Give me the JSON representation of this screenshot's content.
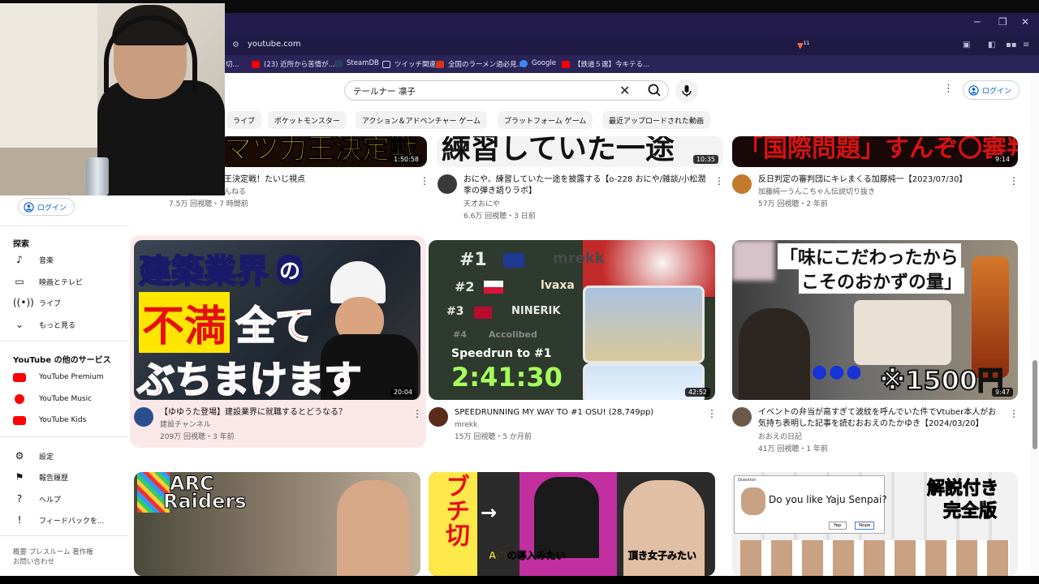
{
  "browser": {
    "url": "youtube.com",
    "shield_count": "11",
    "bookmarks": [
      {
        "label": "(23) 近所から苦情が...",
        "color": "#ff0000"
      },
      {
        "label": "SteamDB",
        "color": "#2a3f5f"
      },
      {
        "label": "ツイッチ関連",
        "color": "#9146ff"
      },
      {
        "label": "全国のラーメン過必見...",
        "color": "#d9331a"
      },
      {
        "label": "Google",
        "color": "#4285f4"
      },
      {
        "label": "【鉄道５選】今キテる...",
        "color": "#ff0000"
      }
    ],
    "bookmark_prefix": "切..."
  },
  "search": {
    "query": "テールナー 凛子"
  },
  "header": {
    "signin": "ログイン"
  },
  "chips": [
    "ライブ",
    "ポケットモンスター",
    "アクション＆アドベンチャー ゲーム",
    "プラットフォーム ゲーム",
    "最近アップロードされた動画"
  ],
  "sidebar": {
    "signin": "ログイン",
    "explore_heading": "探索",
    "explore": [
      {
        "label": "音楽",
        "icon": "music-note-icon"
      },
      {
        "label": "映画とテレビ",
        "icon": "film-icon"
      },
      {
        "label": "ライブ",
        "icon": "live-icon"
      },
      {
        "label": "もっと見る",
        "icon": "chevron-down-icon"
      }
    ],
    "services_heading": "YouTube の他のサービス",
    "services": [
      {
        "label": "YouTube Premium",
        "color": "#ff0000"
      },
      {
        "label": "YouTube Music",
        "color": "#ff0000"
      },
      {
        "label": "YouTube Kids",
        "color": "#ff0000"
      }
    ],
    "settings": [
      {
        "label": "設定",
        "icon": "gear-icon"
      },
      {
        "label": "報告履歴",
        "icon": "flag-icon"
      },
      {
        "label": "ヘルプ",
        "icon": "help-icon"
      },
      {
        "label": "フィードバックを...",
        "icon": "feedback-icon"
      }
    ],
    "footer_1": "概要  プレスルーム  著作権",
    "footer_2": "お問い合わせ"
  },
  "videos_top": [
    {
      "title": "王決定戦！たいじ視点",
      "channel": "んねる",
      "meta": "7.5万 回視聴・7 時間前",
      "duration": "1:50:58"
    },
    {
      "title": "おにや、練習していた一途を披露する【o-228 おにや/雑談/小松潤季の弾き語りラボ】",
      "channel": "天才おにや",
      "meta": "6.6万 回視聴・3 日前",
      "duration": "10:35"
    },
    {
      "title": "反日判定の審判団にキレまくる加藤純一【2023/07/30】",
      "channel": "加藤純一うんこちゃん伝説切り抜き",
      "meta": "57万 回視聴・2 年前",
      "duration": "9:14"
    }
  ],
  "videos_mid": [
    {
      "title": "【ゆゆうた登場】建設業界に就職するとどうなる？",
      "channel": "建設チャンネル",
      "meta": "209万 回視聴・3 年前",
      "duration": "20:04",
      "thumb": {
        "l1": "建築業界",
        "l1b": "の",
        "l2": "不満",
        "l2b": "全て",
        "l3": "ぶちまけます"
      }
    },
    {
      "title": "SPEEDRUNNING MY WAY TO #1 OSU! (28,749pp)",
      "channel": "mrekk",
      "meta": "15万 回視聴・5 か月前",
      "duration": "42:52",
      "thumb": {
        "r1": "#1",
        "n1": "mrekk",
        "r2": "#2",
        "n2": "lvaxa",
        "r3": "#3",
        "n3": "NINERIK",
        "r4": "#4",
        "n4": "Accolibed",
        "s1": "Speedrun to #1",
        "s2": "2:41:30"
      }
    },
    {
      "title": "イベントの弁当が高すぎて波紋を呼んでいた件でVtuber本人がお気持ち表明した記事を読むおおえのたかゆき【2024/03/20】",
      "channel": "おおえの日記",
      "meta": "41万 回視聴・1 年前",
      "duration": "9:47",
      "thumb": {
        "t1": "「味にこだわったから",
        "t2": "こそのおかずの量」",
        "t3": "●●●",
        "t4": "※1500円"
      }
    }
  ],
  "videos_bottom": [
    {
      "thumb": {
        "t1": "ARC",
        "t2": "Raiders"
      }
    },
    {
      "thumb": {
        "t1": "ブチ切",
        "t2": "A◯の導入みたい",
        "t3": "頂き女子みたい"
      }
    },
    {
      "thumb": {
        "dialog_title": "Question",
        "dialog_q": "Do you like Yaju Senpai?",
        "yes": "Yep",
        "no": "Nope",
        "badge1": "解説付き",
        "badge2": "完全版"
      }
    }
  ]
}
